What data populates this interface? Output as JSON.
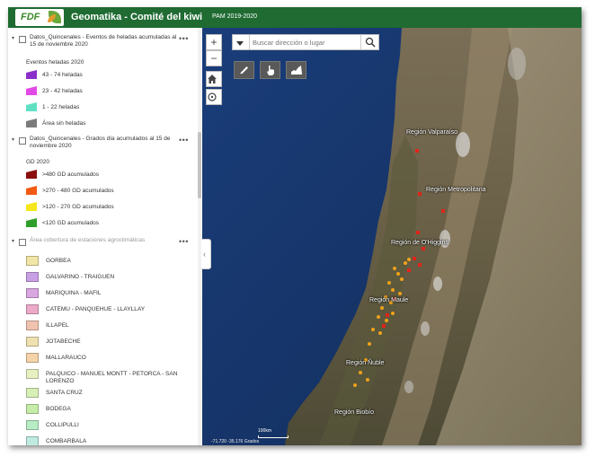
{
  "header": {
    "logo_text": "FDF",
    "title": "Geomatika - Comité del kiwi",
    "subtitle": "PAM 2019-2020"
  },
  "layers": [
    {
      "title": "Datos_Quincenales - Eventos de heladas acumuladas al 15 de noviembre 2020",
      "legend_title": "Eventos heladas 2020",
      "legend": [
        {
          "label": "43 - 74 heladas",
          "color": "#8a2fc9"
        },
        {
          "label": "23 - 42 heladas",
          "color": "#e24ae8"
        },
        {
          "label": "1 - 22 heladas",
          "color": "#5fe0c3"
        },
        {
          "label": "Área sin heladas",
          "color": "#7b7b7b"
        }
      ]
    },
    {
      "title": "Datos_Quincenales - Grados día acumulados al 15 de noviembre 2020",
      "legend_title": "GD 2020",
      "legend": [
        {
          "label": ">480 GD acumulados",
          "color": "#8b0e0e"
        },
        {
          "label": ">270 - 480 GD acumulados",
          "color": "#f25a13"
        },
        {
          "label": ">120 - 270 GD acumulados",
          "color": "#f5e71a"
        },
        {
          "label": "<120 GD acumulados",
          "color": "#2f9e2a"
        }
      ]
    },
    {
      "title": "Área cobertura de estaciones agroclimáticas",
      "zones": [
        {
          "label": "GORBEA",
          "color": "#f2e6a6"
        },
        {
          "label": "GALVARINO - TRAIGUEN",
          "color": "#c9a0e6"
        },
        {
          "label": "MARIQUINA - MAFIL",
          "color": "#d9a6e0"
        },
        {
          "label": "CATEMU - PANQUEHUE - LLAYLLAY",
          "color": "#ecaac8"
        },
        {
          "label": "ILLAPEL",
          "color": "#f0c2b0"
        },
        {
          "label": "JOTABECHE",
          "color": "#efe0b0"
        },
        {
          "label": "MALLARAUCO",
          "color": "#f5d3a8"
        },
        {
          "label": "PALQUICO - MANUEL MONTT - PETORCA - SAN LORENZO",
          "color": "#e6f0c0"
        },
        {
          "label": "SANTA CRUZ",
          "color": "#d8efb6"
        },
        {
          "label": "BODEGA",
          "color": "#c6eda8"
        },
        {
          "label": "COLLIPULLI",
          "color": "#b7ecc4"
        },
        {
          "label": "COMBARBALA",
          "color": "#bfeae0"
        }
      ]
    }
  ],
  "map": {
    "search_placeholder": "Buscar dirección o lugar",
    "zoom_in": "+",
    "zoom_out": "−",
    "regions": [
      {
        "name": "Región Valparaíso"
      },
      {
        "name": "Región Metropolitana"
      },
      {
        "name": "Región de O'Higgins"
      },
      {
        "name": "Región Maule"
      },
      {
        "name": "Región Ñuble"
      },
      {
        "name": "Región Biobío"
      }
    ],
    "scale": "100km",
    "coords": "-71.720  -35.176 Grados"
  }
}
